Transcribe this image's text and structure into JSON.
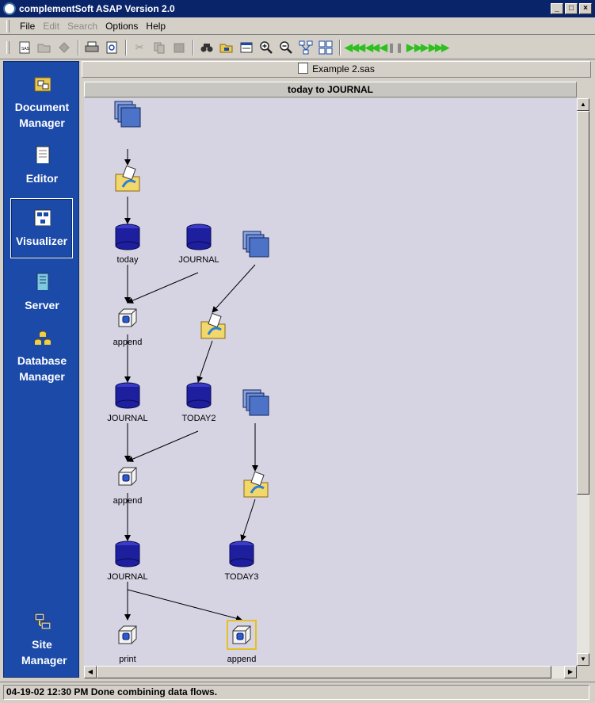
{
  "window": {
    "title": "complementSoft ASAP Version 2.0"
  },
  "menu": [
    {
      "label": "File",
      "enabled": true
    },
    {
      "label": "Edit",
      "enabled": false
    },
    {
      "label": "Search",
      "enabled": false
    },
    {
      "label": "Options",
      "enabled": true
    },
    {
      "label": "Help",
      "enabled": true
    }
  ],
  "toolbar": {
    "buttons": [
      "sas-file-icon",
      "open-folder-icon",
      "save-icon",
      "print-icon",
      "preview-icon",
      "cut-icon",
      "copy-icon",
      "paste-icon",
      "find-icon",
      "browse-icon",
      "window-icon",
      "zoom-in-icon",
      "zoom-out-icon",
      "tree-layout-icon",
      "grid-layout-icon"
    ],
    "nav": [
      "first-icon",
      "rewind-icon",
      "step-back-icon",
      "pause-icon",
      "step-forward-icon",
      "fast-forward-icon",
      "last-icon"
    ]
  },
  "sidebar": {
    "items": [
      {
        "label": "Document Manager",
        "icon": "document-manager-icon",
        "selected": false
      },
      {
        "label": "Editor",
        "icon": "editor-icon",
        "selected": false
      },
      {
        "label": "Visualizer",
        "icon": "visualizer-icon",
        "selected": true
      },
      {
        "label": "Server",
        "icon": "server-icon",
        "selected": false
      },
      {
        "label": "Database Manager",
        "icon": "database-manager-icon",
        "selected": false
      },
      {
        "label": "Site Manager",
        "icon": "site-manager-icon",
        "selected": false
      }
    ]
  },
  "document": {
    "tab": "Example 2.sas",
    "flow_title": "today to JOURNAL"
  },
  "flow": {
    "nodes": [
      {
        "type": "source",
        "label": ""
      },
      {
        "type": "process",
        "label": ""
      },
      {
        "type": "dataset",
        "label": "today"
      },
      {
        "type": "dataset",
        "label": "JOURNAL"
      },
      {
        "type": "source",
        "label": ""
      },
      {
        "type": "step",
        "label": "append"
      },
      {
        "type": "process",
        "label": ""
      },
      {
        "type": "dataset",
        "label": "JOURNAL"
      },
      {
        "type": "dataset",
        "label": "TODAY2"
      },
      {
        "type": "source",
        "label": ""
      },
      {
        "type": "step",
        "label": "append"
      },
      {
        "type": "process",
        "label": ""
      },
      {
        "type": "dataset",
        "label": "JOURNAL"
      },
      {
        "type": "dataset",
        "label": "TODAY3"
      },
      {
        "type": "step",
        "label": "print"
      },
      {
        "type": "step",
        "label": "append",
        "selected": true
      }
    ]
  },
  "status": {
    "text": "04-19-02 12:30 PM Done combining data flows."
  },
  "colors": {
    "titlebar": "#0a246a",
    "sidebar": "#1b4aa8",
    "canvas": "#d6d3e3",
    "dataset": "#1d1f9e",
    "source": "#4d73c9"
  }
}
